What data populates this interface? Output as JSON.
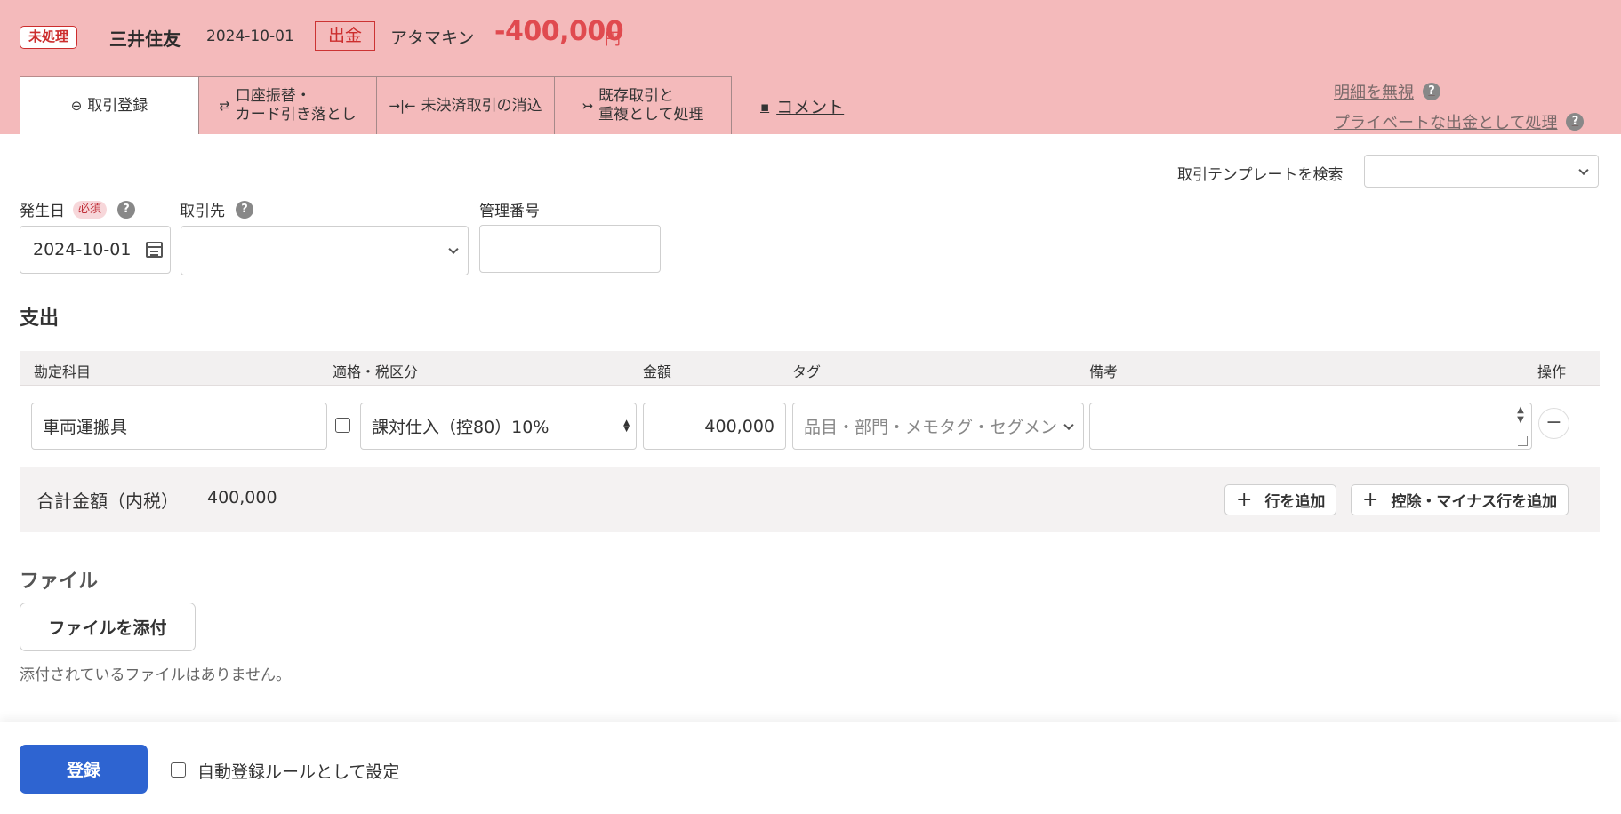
{
  "header": {
    "status": "未処理",
    "bank": "三井住友",
    "date": "2024-10-01",
    "direction": "出金",
    "partner": "アタマキン",
    "amount": "-400,000",
    "currency": "円",
    "background_color": "#f4babb",
    "amount_color": "#e04a4f"
  },
  "tabs": [
    {
      "label": "取引登録",
      "icon": "minus-circle-icon",
      "active": true
    },
    {
      "label_line1": "口座振替・",
      "label_line2": "カード引き落とし",
      "icon": "swap-arrows-icon"
    },
    {
      "label": "未決済取引の消込",
      "icon": "merge-arrows-icon"
    },
    {
      "label_line1": "既存取引と",
      "label_line2": "重複として処理",
      "icon": "branch-arrow-icon"
    }
  ],
  "comment_link": {
    "label": "コメント",
    "icon": "comment-icon"
  },
  "side_links": {
    "ignore": "明細を無視",
    "private": "プライベートな出金として処理",
    "help_icon": "?"
  },
  "form": {
    "template_search_label": "取引テンプレートを検索",
    "template_value": "",
    "date_label": "発生日",
    "required_badge": "必須",
    "date_value": "2024-10-01",
    "partner_label": "取引先",
    "partner_value": "",
    "mgmt_label": "管理番号",
    "mgmt_value": ""
  },
  "expense": {
    "section_title": "支出",
    "columns": [
      "勘定科目",
      "適格・税区分",
      "金額",
      "タグ",
      "備考",
      "操作"
    ],
    "rows": [
      {
        "account": "車両運搬具",
        "qualified_checked": false,
        "tax": "課対仕入（控80）10%",
        "amount": "400,000",
        "tag_placeholder": "品目・部門・メモタグ・セグメント",
        "memo": "",
        "remove_label": "−"
      }
    ],
    "total_label": "合計金額（内税）",
    "total_value": "400,000",
    "add_row": "行を追加",
    "add_deduct_row": "控除・マイナス行を追加",
    "plus": "+"
  },
  "files": {
    "title": "ファイル",
    "attach_button": "ファイルを添付",
    "empty_message": "添付されているファイルはありません。"
  },
  "footer": {
    "submit": "登録",
    "submit_color": "#2e64d1",
    "auto_rule_label": "自動登録ルールとして設定",
    "auto_rule_checked": false
  }
}
